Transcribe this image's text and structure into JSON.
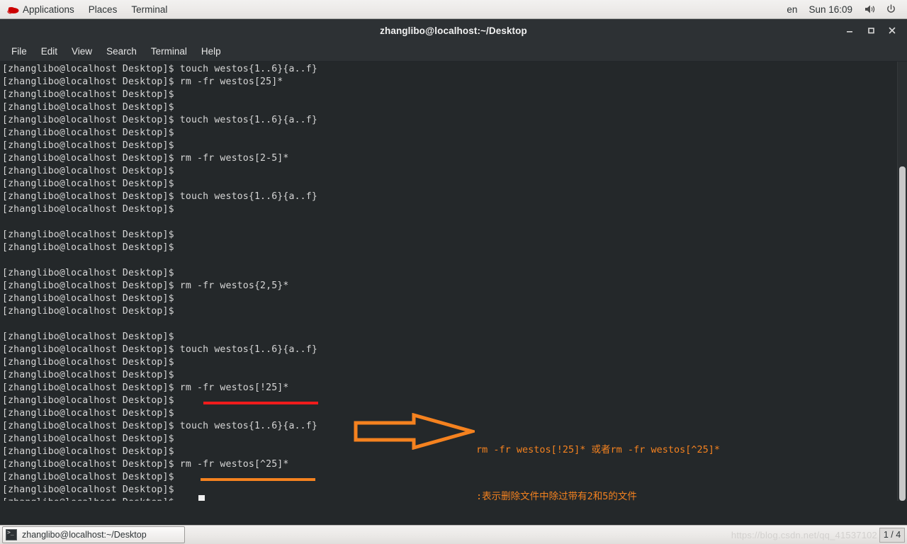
{
  "top_panel": {
    "logo_icon": "redhat-logo-icon",
    "items": [
      {
        "label": "Applications"
      },
      {
        "label": "Places"
      },
      {
        "label": "Terminal"
      }
    ],
    "language": "en",
    "clock": "Sun 16:09",
    "volume_icon": "volume-icon",
    "power_icon": "power-icon"
  },
  "window": {
    "title": "zhanglibo@localhost:~/Desktop",
    "buttons": {
      "minimize": "–",
      "maximize": "■",
      "close": "✕"
    },
    "menu": [
      {
        "label": "File"
      },
      {
        "label": "Edit"
      },
      {
        "label": "View"
      },
      {
        "label": "Search"
      },
      {
        "label": "Terminal"
      },
      {
        "label": "Help"
      }
    ]
  },
  "terminal": {
    "prompt": "[zhanglibo@localhost Desktop]$",
    "lines": [
      "[zhanglibo@localhost Desktop]$ touch westos{1..6}{a..f}",
      "[zhanglibo@localhost Desktop]$ rm -fr westos[25]*",
      "[zhanglibo@localhost Desktop]$ ",
      "[zhanglibo@localhost Desktop]$ ",
      "[zhanglibo@localhost Desktop]$ touch westos{1..6}{a..f}",
      "[zhanglibo@localhost Desktop]$ ",
      "[zhanglibo@localhost Desktop]$ ",
      "[zhanglibo@localhost Desktop]$ rm -fr westos[2-5]*",
      "[zhanglibo@localhost Desktop]$ ",
      "[zhanglibo@localhost Desktop]$ ",
      "[zhanglibo@localhost Desktop]$ touch westos{1..6}{a..f}",
      "[zhanglibo@localhost Desktop]$ ",
      "",
      "[zhanglibo@localhost Desktop]$ ",
      "[zhanglibo@localhost Desktop]$ ",
      "",
      "[zhanglibo@localhost Desktop]$ ",
      "[zhanglibo@localhost Desktop]$ rm -fr westos{2,5}*",
      "[zhanglibo@localhost Desktop]$ ",
      "[zhanglibo@localhost Desktop]$ ",
      "",
      "[zhanglibo@localhost Desktop]$ ",
      "[zhanglibo@localhost Desktop]$ touch westos{1..6}{a..f}",
      "[zhanglibo@localhost Desktop]$ ",
      "[zhanglibo@localhost Desktop]$ ",
      "[zhanglibo@localhost Desktop]$ rm -fr westos[!25]*",
      "[zhanglibo@localhost Desktop]$ ",
      "[zhanglibo@localhost Desktop]$ ",
      "[zhanglibo@localhost Desktop]$ touch westos{1..6}{a..f}",
      "[zhanglibo@localhost Desktop]$ ",
      "[zhanglibo@localhost Desktop]$ ",
      "[zhanglibo@localhost Desktop]$ rm -fr westos[^25]*",
      "[zhanglibo@localhost Desktop]$ ",
      "[zhanglibo@localhost Desktop]$ ",
      "[zhanglibo@localhost Desktop]$ "
    ]
  },
  "annotations": {
    "arrow_icon": "right-arrow-icon",
    "note_line_1": "rm -fr westos[!25]* 或者rm -fr westos[^25]*",
    "note_line_2": ":表示删除文件中除过带有2和5的文件",
    "red_color": "#f01c1c",
    "orange_color": "#f5821f"
  },
  "taskbar": {
    "window_button_label": "zhanglibo@localhost:~/Desktop",
    "terminal_icon": "terminal-icon",
    "watermark": "https://blog.csdn.net/qq_41537102",
    "workspace": "1 / 4"
  }
}
